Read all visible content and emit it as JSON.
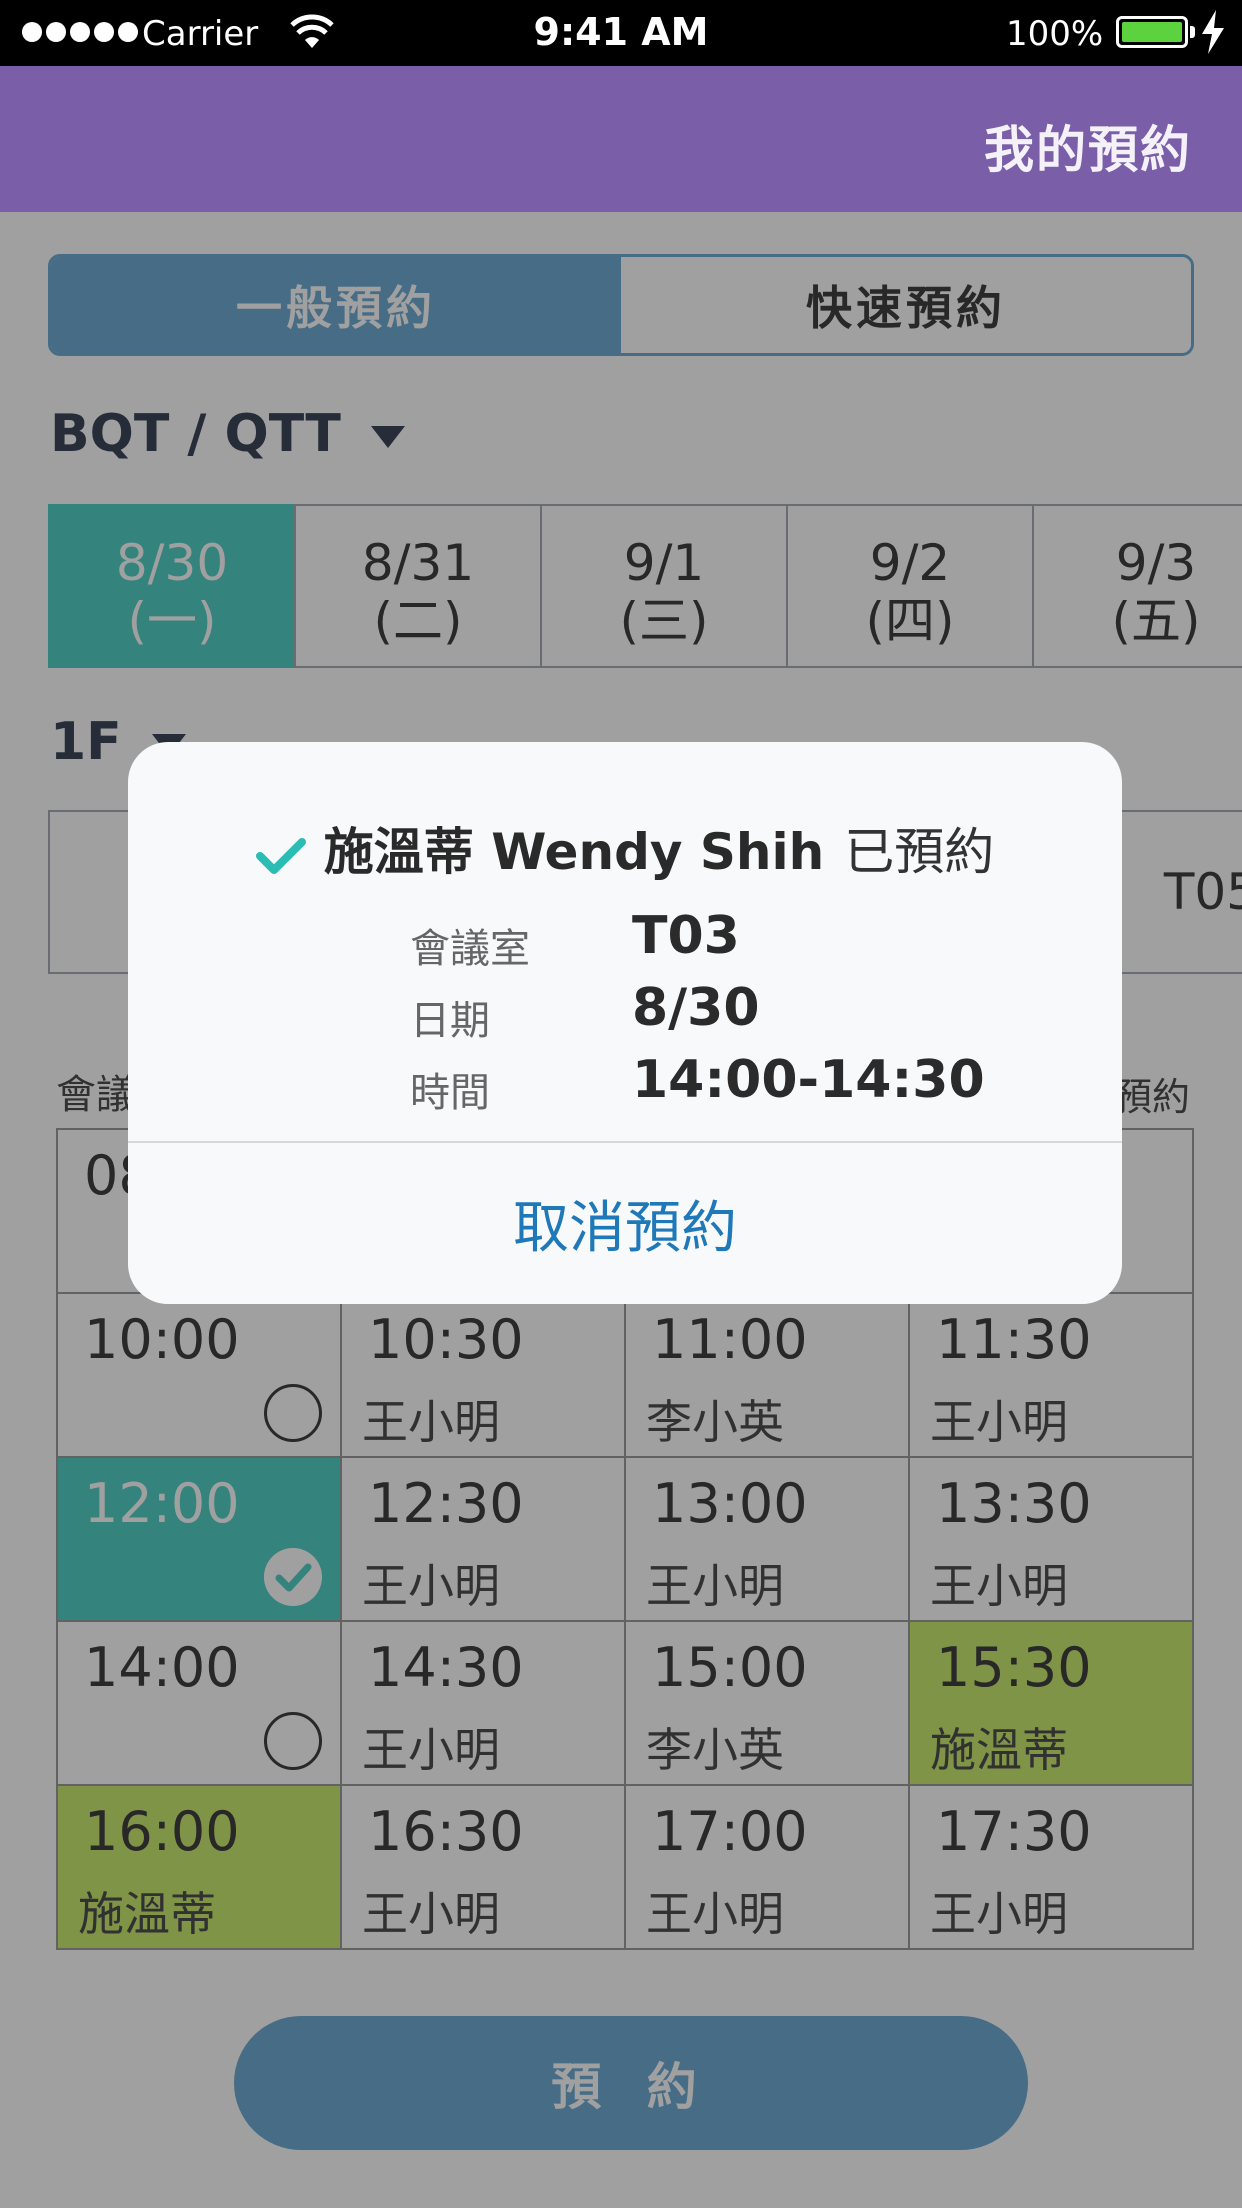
{
  "status_bar": {
    "carrier": "Carrier",
    "time": "9:41 AM",
    "battery": "100%"
  },
  "header": {
    "title": "我的預約"
  },
  "segment": {
    "general": "一般預約",
    "quick": "快速預約"
  },
  "building": "BQT / QTT",
  "dates": [
    {
      "date": "8/30",
      "weekday": "(一)"
    },
    {
      "date": "8/31",
      "weekday": "(二)"
    },
    {
      "date": "9/1",
      "weekday": "(三)"
    },
    {
      "date": "9/2",
      "weekday": "(四)"
    },
    {
      "date": "9/3",
      "weekday": "(五)"
    }
  ],
  "floor": "1F",
  "rooms": [
    "",
    "",
    "",
    "",
    "T05"
  ],
  "legend": {
    "left": "會議",
    "right": "預約"
  },
  "slots": [
    {
      "time": "08",
      "name": ""
    },
    {
      "time": "",
      "name": ""
    },
    {
      "time": "",
      "name": ""
    },
    {
      "time": "",
      "name": ""
    },
    {
      "time": "10:00",
      "name": ""
    },
    {
      "time": "10:30",
      "name": "王小明"
    },
    {
      "time": "11:00",
      "name": "李小英"
    },
    {
      "time": "11:30",
      "name": "王小明"
    },
    {
      "time": "12:00",
      "name": ""
    },
    {
      "time": "12:30",
      "name": "王小明"
    },
    {
      "time": "13:00",
      "name": "王小明"
    },
    {
      "time": "13:30",
      "name": "王小明"
    },
    {
      "time": "14:00",
      "name": ""
    },
    {
      "time": "14:30",
      "name": "王小明"
    },
    {
      "time": "15:00",
      "name": "李小英"
    },
    {
      "time": "15:30",
      "name": "施溫蒂"
    },
    {
      "time": "16:00",
      "name": "施溫蒂"
    },
    {
      "time": "16:30",
      "name": "王小明"
    },
    {
      "time": "17:00",
      "name": "王小明"
    },
    {
      "time": "17:30",
      "name": "王小明"
    }
  ],
  "book_button": "預 約",
  "modal": {
    "name": "施溫蒂 Wendy Shih",
    "status": "已預約",
    "room_label": "會議室",
    "room_value": "T03",
    "date_label": "日期",
    "date_value": "8/30",
    "time_label": "時間",
    "time_value": "14:00-14:30",
    "cancel": "取消預約"
  },
  "colors": {
    "accent_blue": "#5a9fd0",
    "selected_teal": "#38c9bf",
    "mine_green": "#c2e95c",
    "header_purple": "#7a5fa8",
    "link_blue": "#1f78b8"
  }
}
